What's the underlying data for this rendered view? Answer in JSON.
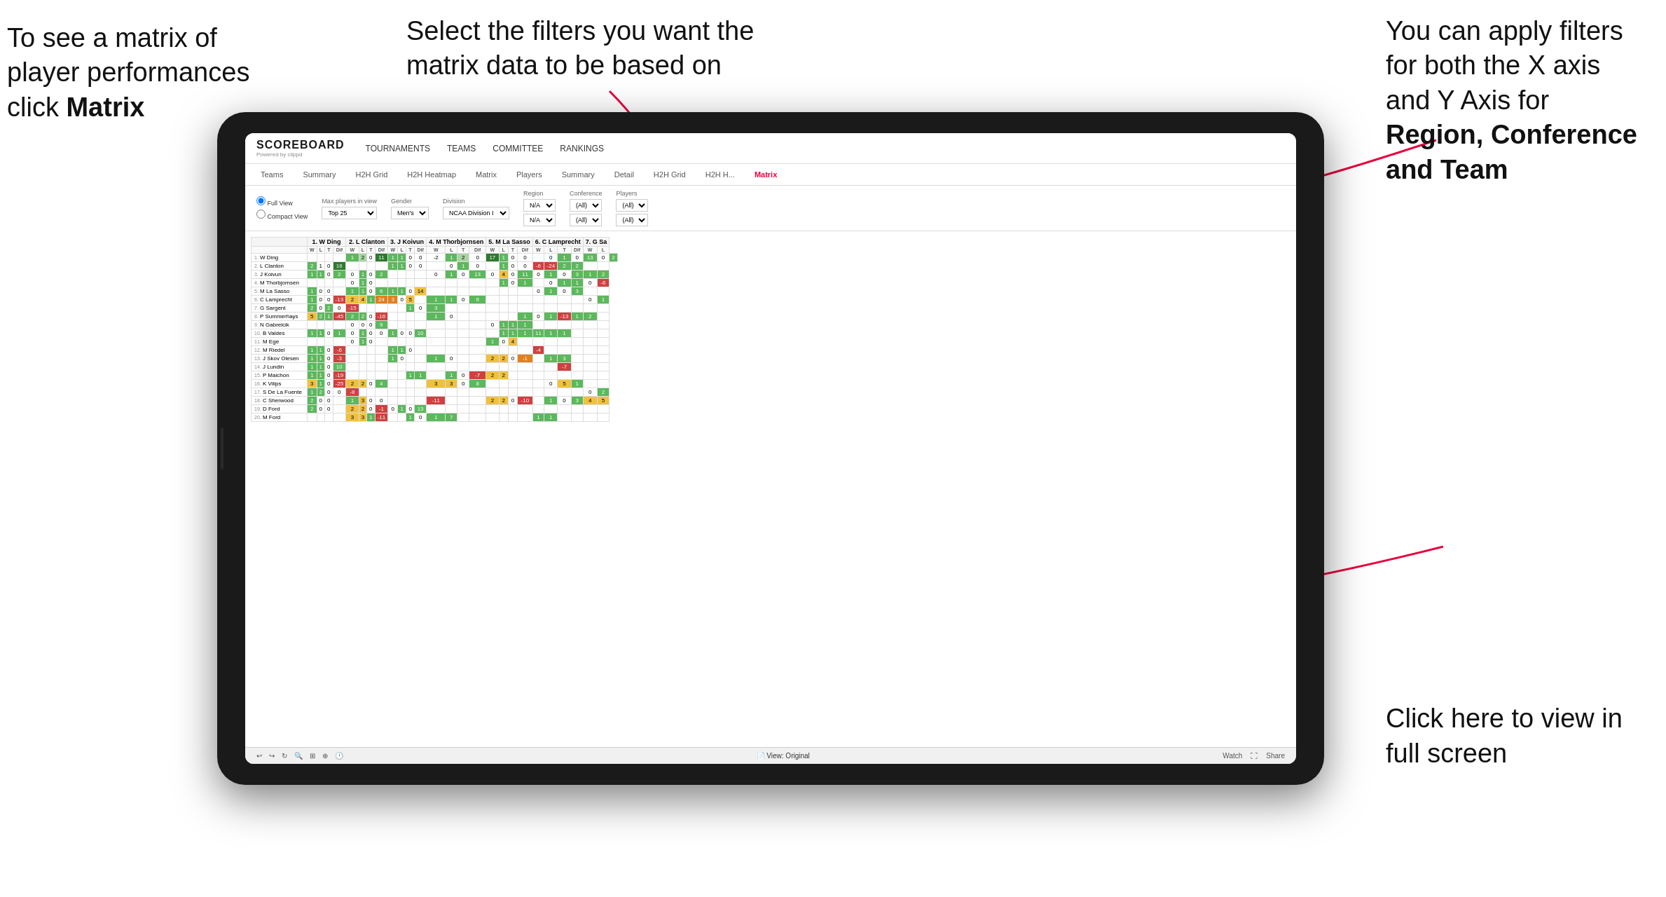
{
  "annotations": {
    "topleft": {
      "line1": "To see a matrix of",
      "line2": "player performances",
      "line3_normal": "click ",
      "line3_bold": "Matrix"
    },
    "topcenter": {
      "text": "Select the filters you want the matrix data to be based on"
    },
    "topright": {
      "line1": "You  can apply filters for both the X axis and Y Axis for ",
      "bold1": "Region, Conference and Team"
    },
    "bottomright": {
      "line1": "Click here to view in full screen"
    }
  },
  "app": {
    "logo": "SCOREBOARD",
    "logo_sub": "Powered by clippd",
    "nav_items": [
      "TOURNAMENTS",
      "TEAMS",
      "COMMITTEE",
      "RANKINGS"
    ]
  },
  "sub_tabs": [
    {
      "label": "Teams",
      "active": false
    },
    {
      "label": "Summary",
      "active": false
    },
    {
      "label": "H2H Grid",
      "active": false
    },
    {
      "label": "H2H Heatmap",
      "active": false
    },
    {
      "label": "Matrix",
      "active": false
    },
    {
      "label": "Players",
      "active": false
    },
    {
      "label": "Summary",
      "active": false
    },
    {
      "label": "Detail",
      "active": false
    },
    {
      "label": "H2H Grid",
      "active": false
    },
    {
      "label": "H2H H...",
      "active": false
    },
    {
      "label": "Matrix",
      "active": true
    }
  ],
  "filters": {
    "view_full": "Full View",
    "view_compact": "Compact View",
    "max_players_label": "Max players in view",
    "max_players_value": "Top 25",
    "gender_label": "Gender",
    "gender_value": "Men's",
    "division_label": "Division",
    "division_value": "NCAA Division I",
    "region_label": "Region",
    "region_values": [
      "N/A",
      "N/A"
    ],
    "conference_label": "Conference",
    "conference_values": [
      "(All)",
      "(All)"
    ],
    "players_label": "Players",
    "players_values": [
      "(All)",
      "(All)"
    ]
  },
  "matrix": {
    "col_headers": [
      "1. W Ding",
      "2. L Clanton",
      "3. J Koivun",
      "4. M Thorbjornsen",
      "5. M La Sasso",
      "6. C Lamprecht",
      "7. G Sa"
    ],
    "sub_cols": [
      "W",
      "L",
      "T",
      "Dif"
    ],
    "rows": [
      {
        "num": "1.",
        "name": "W Ding",
        "cells": [
          "",
          "",
          "",
          "",
          "1",
          "2",
          "0",
          "11",
          "1",
          "1",
          "0",
          "0",
          "-2",
          "1",
          "2",
          "0",
          "17",
          "1",
          "0",
          "0",
          "",
          "0",
          "1",
          "0",
          "13",
          "0",
          "2"
        ]
      },
      {
        "num": "2.",
        "name": "L Clanton",
        "cells": [
          "2",
          "1",
          "0",
          "16",
          "",
          "",
          "",
          "",
          "1",
          "1",
          "0",
          "0",
          "",
          "0",
          "1",
          "0",
          "",
          "1",
          "0",
          "0",
          "-6",
          "-24",
          "2",
          "2"
        ]
      },
      {
        "num": "3.",
        "name": "J Koivun",
        "cells": [
          "1",
          "1",
          "0",
          "2",
          "0",
          "1",
          "0",
          "2",
          "",
          "",
          "",
          "",
          "0",
          "1",
          "0",
          "13",
          "0",
          "4",
          "0",
          "11",
          "0",
          "1",
          "0",
          "3",
          "1",
          "2"
        ]
      },
      {
        "num": "4.",
        "name": "M Thorbjornsen",
        "cells": [
          "",
          "",
          "",
          "",
          "0",
          "1",
          "0",
          "",
          "",
          "",
          "",
          "",
          "",
          "",
          "",
          "",
          "",
          "1",
          "0",
          "1",
          "",
          "0",
          "1",
          "1",
          "0",
          "-6"
        ]
      },
      {
        "num": "5.",
        "name": "M La Sasso",
        "cells": [
          "1",
          "0",
          "0",
          "",
          "1",
          "1",
          "0",
          "6",
          "1",
          "1",
          "0",
          "14",
          "",
          "",
          "",
          "",
          "",
          "",
          "",
          "",
          "0",
          "1",
          "0",
          "3",
          ""
        ]
      },
      {
        "num": "6.",
        "name": "C Lamprecht",
        "cells": [
          "1",
          "0",
          "0",
          "-13",
          "2",
          "4",
          "1",
          "24",
          "3",
          "0",
          "5",
          "",
          "1",
          "1",
          "0",
          "6",
          "",
          "",
          "",
          "",
          "",
          "",
          "",
          "",
          "0",
          "1"
        ]
      },
      {
        "num": "7.",
        "name": "G Sargent",
        "cells": [
          "2",
          "0",
          "2",
          "0",
          "-15",
          "",
          "",
          "",
          "",
          "",
          "1",
          "0",
          "3",
          "",
          "",
          "",
          "",
          "",
          "",
          "",
          "",
          "",
          "",
          ""
        ]
      },
      {
        "num": "8.",
        "name": "P Summerhays",
        "cells": [
          "5",
          "2",
          "1",
          "-45",
          "2",
          "2",
          "0",
          "-16",
          "",
          "",
          "",
          "",
          "1",
          "0",
          "",
          "",
          "",
          "",
          "",
          "1",
          "0",
          "1",
          "-13",
          "1",
          "2"
        ]
      },
      {
        "num": "9.",
        "name": "N Gabrelcik",
        "cells": [
          "",
          "",
          "",
          "",
          "0",
          "0",
          "0",
          "9",
          "",
          "",
          "",
          "",
          "",
          "",
          "",
          "",
          "0",
          "1",
          "1",
          "1",
          ""
        ]
      },
      {
        "num": "10.",
        "name": "B Valdes",
        "cells": [
          "1",
          "1",
          "0",
          "1",
          "0",
          "1",
          "0",
          "0",
          "1",
          "0",
          "0",
          "10",
          "",
          "",
          "",
          "",
          "",
          "1",
          "1",
          "1",
          "11",
          "1",
          "1"
        ]
      },
      {
        "num": "11.",
        "name": "M Ege",
        "cells": [
          "",
          "",
          "",
          "",
          "0",
          "1",
          "0",
          "",
          "",
          "",
          "",
          "",
          "",
          "",
          "",
          "",
          "1",
          "0",
          "4",
          "",
          ""
        ]
      },
      {
        "num": "12.",
        "name": "M Riedel",
        "cells": [
          "1",
          "1",
          "0",
          "-6",
          "",
          "",
          "",
          "",
          "1",
          "1",
          "0",
          "",
          "",
          "",
          "",
          "",
          "",
          "",
          "",
          "",
          "-4",
          ""
        ]
      },
      {
        "num": "13.",
        "name": "J Skov Olesen",
        "cells": [
          "1",
          "1",
          "0",
          "-3",
          "",
          "",
          "",
          "",
          "1",
          "0",
          "",
          "",
          "1",
          "0",
          "",
          "",
          "2",
          "2",
          "0",
          "-1",
          "",
          "1",
          "3"
        ]
      },
      {
        "num": "14.",
        "name": "J Lundin",
        "cells": [
          "1",
          "1",
          "0",
          "10",
          "",
          "",
          "",
          "",
          "",
          "",
          "",
          "",
          "",
          "",
          "",
          "",
          "",
          "",
          "",
          "",
          "",
          "",
          "-7",
          ""
        ]
      },
      {
        "num": "15.",
        "name": "P Maichon",
        "cells": [
          "1",
          "1",
          "0",
          "-19",
          "",
          "",
          "",
          "",
          "",
          "",
          "1",
          "1",
          "",
          "1",
          "0",
          "-7",
          "2",
          "2"
        ]
      },
      {
        "num": "16.",
        "name": "K Vilips",
        "cells": [
          "3",
          "1",
          "0",
          "-25",
          "2",
          "2",
          "0",
          "4",
          "",
          "",
          "",
          "",
          "3",
          "3",
          "0",
          "8",
          "",
          "",
          "",
          "",
          "",
          "0",
          "5",
          "1"
        ]
      },
      {
        "num": "17.",
        "name": "S De La Fuente",
        "cells": [
          "1",
          "2",
          "0",
          "0",
          "-8",
          "",
          "",
          "",
          "",
          "",
          "",
          "",
          "",
          "",
          "",
          "",
          "",
          "",
          "",
          "",
          "0",
          "2"
        ]
      },
      {
        "num": "18.",
        "name": "C Sherwood",
        "cells": [
          "2",
          "0",
          "0",
          "",
          "1",
          "3",
          "0",
          "0",
          "",
          "",
          "",
          "",
          "-11",
          "",
          "",
          "",
          "2",
          "2",
          "0",
          "-10",
          "",
          "1",
          "0",
          "3",
          "4",
          "5"
        ]
      },
      {
        "num": "19.",
        "name": "D Ford",
        "cells": [
          "2",
          "0",
          "0",
          "",
          "2",
          "2",
          "0",
          "-1",
          "0",
          "1",
          "0",
          "13",
          "",
          "",
          "",
          "",
          "",
          "",
          "",
          "",
          ""
        ]
      },
      {
        "num": "20.",
        "name": "M Ford",
        "cells": [
          "",
          "",
          "",
          "",
          "3",
          "3",
          "1",
          "-11",
          "",
          "",
          "1",
          "0",
          "1",
          "7",
          "",
          "",
          "",
          "",
          "",
          "",
          "1",
          "1"
        ]
      }
    ]
  },
  "toolbar": {
    "view_original": "View: Original",
    "watch": "Watch",
    "share": "Share"
  }
}
